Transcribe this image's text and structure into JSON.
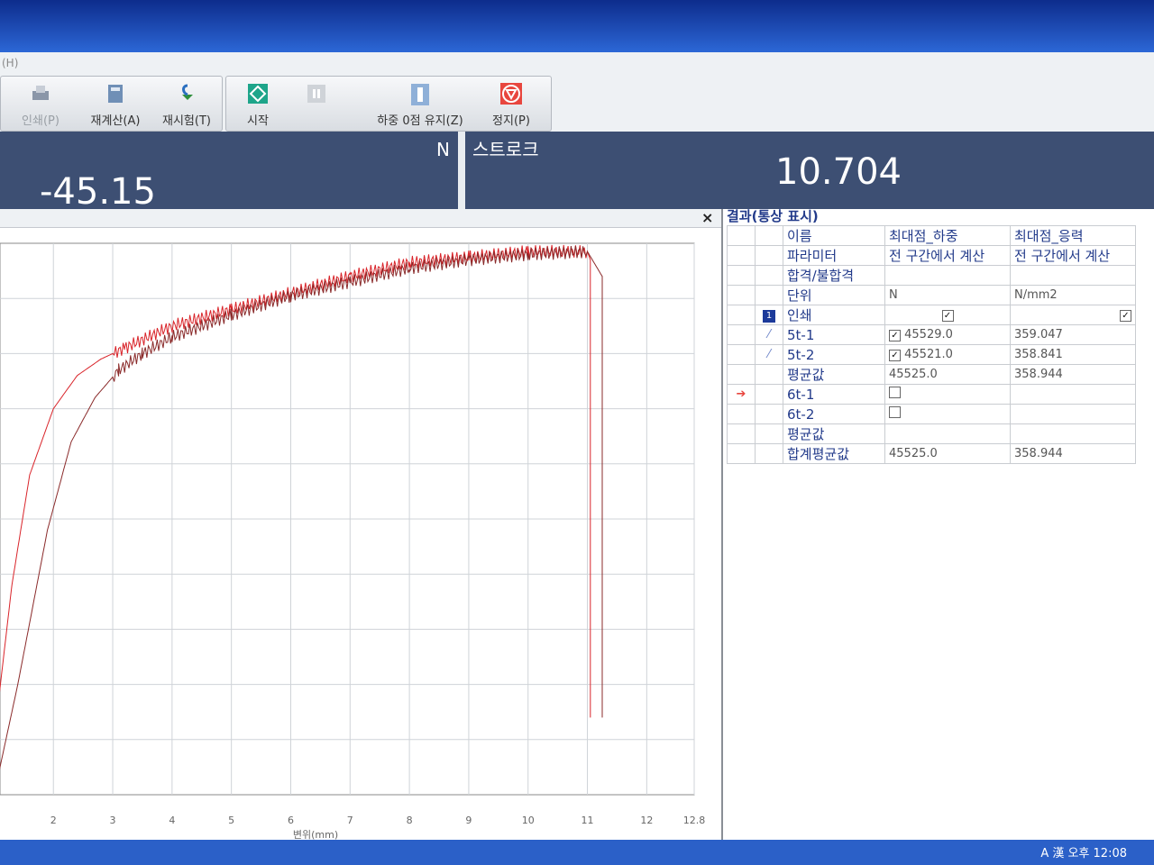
{
  "menu": {
    "help": "(H)"
  },
  "toolbar": {
    "print": "인쇄(P)",
    "recalc": "재계산(A)",
    "retest": "재시험(T)",
    "start": "시작",
    "load_zero_hold": "하중 0점 유지(Z)",
    "stop": "정지(P)"
  },
  "load_panel": {
    "unit": "N",
    "value": "-45.15"
  },
  "stroke_panel": {
    "label": "스트로크",
    "value": "10.704"
  },
  "result_panel": {
    "title": "결과(통상 표시)",
    "row_labels": [
      "이름",
      "파라미터",
      "합격/불합격",
      "단위",
      "인쇄",
      "5t-1",
      "5t-2",
      "평균값",
      "6t-1",
      "6t-2",
      "평균값",
      "합계평균값"
    ],
    "col1": {
      "name": "최대점_하중",
      "param": "전 구간에서 계산",
      "unit": "N",
      "v1": "45529.0",
      "v2": "45521.0",
      "avg": "45525.0",
      "total": "45525.0"
    },
    "col2": {
      "name": "최대점_응력",
      "param": "전 구간에서 계산",
      "unit": "N/mm2",
      "v1": "359.047",
      "v2": "358.841",
      "avg": "358.944",
      "total": "358.944"
    },
    "print_badge": "1"
  },
  "chart_data": {
    "type": "line",
    "xlabel": "변위(mm)",
    "x_ticks": [
      "2",
      "3",
      "4",
      "5",
      "6",
      "7",
      "8",
      "9",
      "10",
      "11",
      "12",
      "12.8"
    ],
    "xlim": [
      1.1,
      12.8
    ],
    "ylim": [
      0,
      1
    ],
    "series": [
      {
        "color": "#d9242a",
        "x": [
          1.0,
          1.3,
          1.6,
          2.0,
          2.4,
          2.8,
          3.2,
          4.0,
          5.0,
          6.0,
          7.0,
          8.0,
          9.0,
          10.0,
          11.0,
          11.05,
          11.05
        ],
        "y": [
          0.1,
          0.38,
          0.58,
          0.7,
          0.76,
          0.79,
          0.81,
          0.85,
          0.88,
          0.91,
          0.94,
          0.965,
          0.975,
          0.985,
          0.985,
          0.97,
          0.14
        ]
      },
      {
        "color": "#8a2a2a",
        "x": [
          1.0,
          1.4,
          1.9,
          2.3,
          2.7,
          3.1,
          3.5,
          4.0,
          5.0,
          6.0,
          7.0,
          8.0,
          9.0,
          10.0,
          11.0,
          11.25,
          11.25
        ],
        "y": [
          0.0,
          0.2,
          0.48,
          0.64,
          0.72,
          0.77,
          0.8,
          0.83,
          0.87,
          0.905,
          0.93,
          0.955,
          0.97,
          0.98,
          0.985,
          0.94,
          0.14
        ]
      }
    ]
  },
  "taskbar": {
    "tray": "A 漢   오후 12:08"
  }
}
